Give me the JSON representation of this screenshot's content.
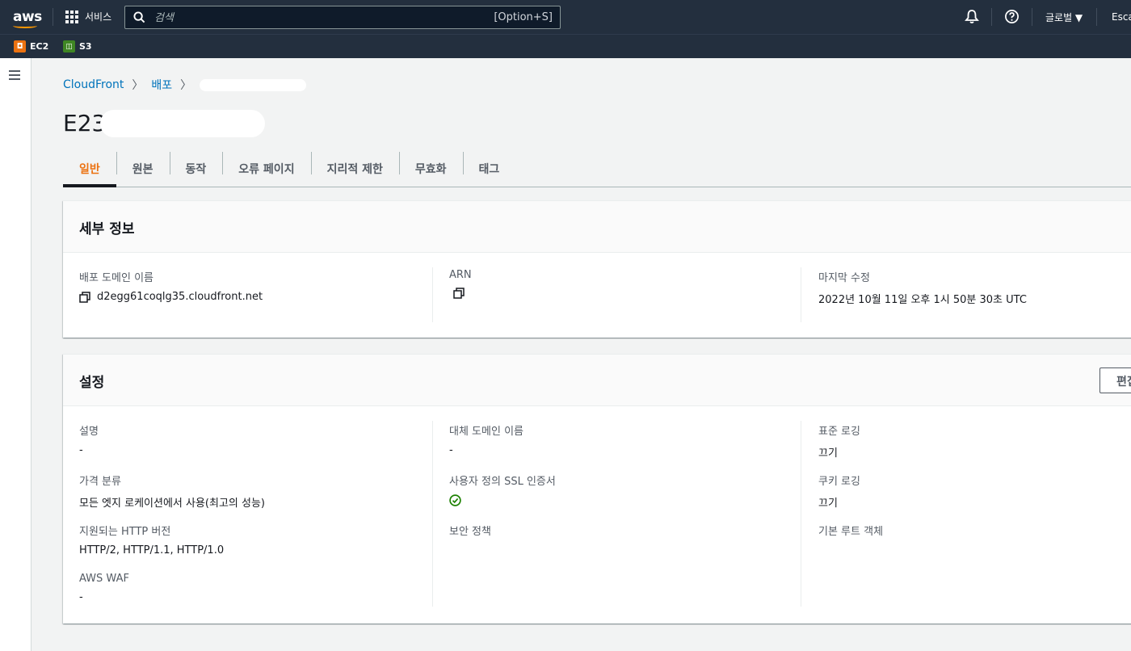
{
  "topnav": {
    "logo": "aws",
    "services_label": "서비스",
    "search_placeholder": "검색",
    "search_shortcut": "[Option+S]",
    "region": "글로벌 ▼",
    "account": "Escape"
  },
  "favorites": [
    {
      "label": "EC2",
      "icon": "ec2-icon",
      "color": "#ec7211"
    },
    {
      "label": "S3",
      "icon": "s3-icon",
      "color": "#3f8624"
    }
  ],
  "breadcrumb": {
    "items": [
      "CloudFront",
      "배포"
    ]
  },
  "page_title": "E23",
  "tabs": [
    "일반",
    "원본",
    "동작",
    "오류 페이지",
    "지리적 제한",
    "무효화",
    "태그"
  ],
  "details": {
    "header": "세부 정보",
    "domain_label": "배포 도메인 이름",
    "domain_value": "d2egg61coqlg35.cloudfront.net",
    "arn_label": "ARN",
    "modified_label": "마지막 수정",
    "modified_value": "2022년 10월 11일 오후 1시 50분 30초 UTC"
  },
  "settings": {
    "header": "설정",
    "edit_label": "편집",
    "description_label": "설명",
    "description_value": "-",
    "price_class_label": "가격 분류",
    "price_class_value": "모든 엣지 로케이션에서 사용(최고의 성능)",
    "http_label": "지원되는 HTTP 버전",
    "http_value": "HTTP/2, HTTP/1.1, HTTP/1.0",
    "waf_label": "AWS WAF",
    "waf_value": "-",
    "alt_domain_label": "대체 도메인 이름",
    "alt_domain_value": "-",
    "ssl_label": "사용자 정의 SSL 인증서",
    "security_policy_label": "보안 정책",
    "std_logging_label": "표준 로깅",
    "std_logging_value": "끄기",
    "cookie_logging_label": "쿠키 로깅",
    "cookie_logging_value": "끄기",
    "root_object_label": "기본 루트 객체"
  },
  "colors": {
    "nav": "#232f3e",
    "accent": "#ec7211",
    "link": "#0073bb",
    "success": "#1d8102"
  }
}
